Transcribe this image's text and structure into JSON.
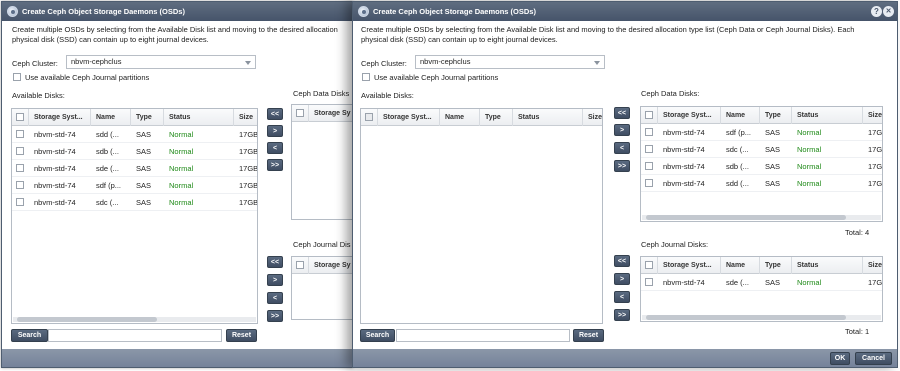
{
  "dialog_title": "Create Ceph Object Storage Daemons (OSDs)",
  "description_left": [
    "Create multiple OSDs by selecting from the Available Disk list and moving to the desired allocation",
    "physical disk (SSD) can contain up to eight journal devices."
  ],
  "description_right": [
    "Create multiple OSDs by selecting from the Available Disk list and moving to the desired allocation type list (Ceph Data or Ceph Journal Disks). Each",
    "physical disk (SSD) can contain up to eight journal devices."
  ],
  "ceph_cluster_label": "Ceph Cluster:",
  "ceph_cluster_value": "nbvm-cephclus",
  "journal_partitions_label": "Use available Ceph Journal partitions",
  "available_disks_label": "Available Disks:",
  "ceph_data_disks_label": "Ceph Data Disks:",
  "ceph_journal_disks_label": "Ceph Journal Disks:",
  "ceph_data_disks_label_cut": "Ceph Data Disks",
  "ceph_journal_disks_label_cut": "Ceph Journal Dis",
  "columns": {
    "storage": "Storage Syst...",
    "name": "Name",
    "type": "Type",
    "status": "Status",
    "size": "Size",
    "storage_cut": "Storage Sy"
  },
  "left_available_rows": [
    {
      "storage": "nbvm-std-74",
      "name": "sdd (...",
      "type": "SAS",
      "status": "Normal",
      "size": "17GB"
    },
    {
      "storage": "nbvm-std-74",
      "name": "sdb (...",
      "type": "SAS",
      "status": "Normal",
      "size": "17GB"
    },
    {
      "storage": "nbvm-std-74",
      "name": "sde (...",
      "type": "SAS",
      "status": "Normal",
      "size": "17GB"
    },
    {
      "storage": "nbvm-std-74",
      "name": "sdf (p...",
      "type": "SAS",
      "status": "Normal",
      "size": "17GB"
    },
    {
      "storage": "nbvm-std-74",
      "name": "sdc (...",
      "type": "SAS",
      "status": "Normal",
      "size": "17GB"
    }
  ],
  "right_data_rows": [
    {
      "storage": "nbvm-std-74",
      "name": "sdf (p...",
      "type": "SAS",
      "status": "Normal",
      "size": "17G"
    },
    {
      "storage": "nbvm-std-74",
      "name": "sdc (...",
      "type": "SAS",
      "status": "Normal",
      "size": "17G"
    },
    {
      "storage": "nbvm-std-74",
      "name": "sdb (...",
      "type": "SAS",
      "status": "Normal",
      "size": "17G"
    },
    {
      "storage": "nbvm-std-74",
      "name": "sdd (...",
      "type": "SAS",
      "status": "Normal",
      "size": "17G"
    }
  ],
  "right_journal_rows": [
    {
      "storage": "nbvm-std-74",
      "name": "sde (...",
      "type": "SAS",
      "status": "Normal",
      "size": "17G"
    }
  ],
  "move_buttons": {
    "all_left": "<<",
    "one_right": ">",
    "one_left": "<",
    "all_right": ">>"
  },
  "search_label": "Search",
  "reset_label": "Reset",
  "total_data": "Total:   4",
  "total_journal": "Total:   1",
  "ok_label": "OK",
  "cancel_label": "Cancel",
  "help_icon": "?",
  "close_icon": "✕",
  "status_color": "#1f8a18"
}
